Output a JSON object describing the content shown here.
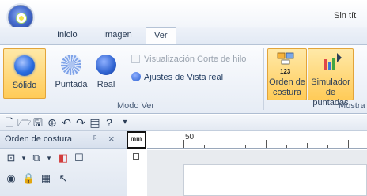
{
  "window": {
    "title": "Sin tít"
  },
  "tabs": [
    {
      "label": "Inicio"
    },
    {
      "label": "Imagen"
    },
    {
      "label": "Ver"
    }
  ],
  "ribbon": {
    "modo_ver": {
      "group_label": "Modo Ver",
      "buttons": [
        {
          "label": "Sólido",
          "icon": "solid-circle-icon",
          "selected": true
        },
        {
          "label": "Puntada",
          "icon": "stitch-circle-icon",
          "selected": false
        },
        {
          "label": "Real",
          "icon": "real-circle-icon",
          "selected": false
        }
      ],
      "checkbox_label": "Visualización Corte de hilo",
      "settings_label": "Ajustes de Vista real"
    },
    "mostrar": {
      "group_label": "Mostra",
      "orden_line1": "Orden de",
      "orden_line2": "costura",
      "orden_badge": "123",
      "sim_line1": "Simulador",
      "sim_line2": "de puntadas"
    }
  },
  "quick_access": {
    "icons": [
      "new-file-icon",
      "open-file-icon",
      "save-icon",
      "zoom-icon",
      "undo-icon",
      "redo-icon",
      "view-icon",
      "help-icon",
      "customize-icon"
    ]
  },
  "panel": {
    "title": "Orden de costura",
    "pin": "ᵖ",
    "close": "×"
  },
  "ruler": {
    "unit_button": "mm",
    "label_50": "50"
  },
  "colors": {
    "accent": "#ffcb58",
    "selected_border": "#e2a43a",
    "ribbon_bg": "#e6ecf5"
  }
}
